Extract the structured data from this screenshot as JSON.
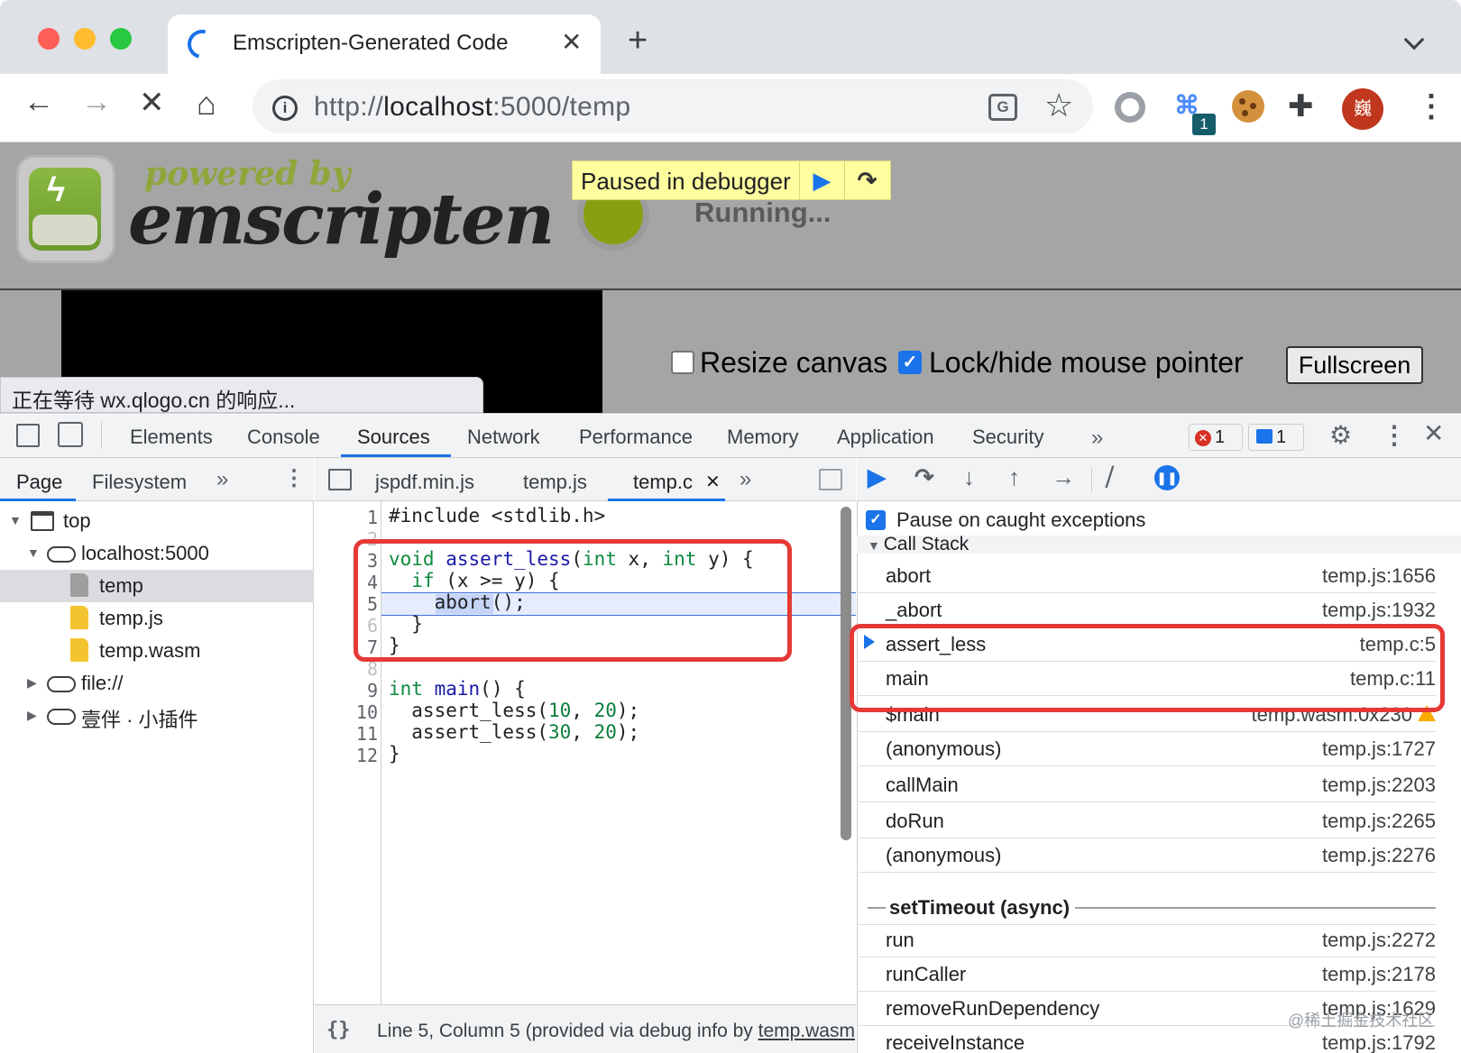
{
  "browser": {
    "tab_title": "Emscripten-Generated Code",
    "url_prefix": "http://",
    "url_host": "localhost",
    "url_rest": ":5000/temp",
    "extension_badge": "1",
    "avatar_text": "巍",
    "status_text": "正在等待 wx.qlogo.cn 的响应..."
  },
  "page": {
    "powered_by": "powered by",
    "brand": "emscripten",
    "running": "Running...",
    "paused_banner": "Paused in debugger",
    "resize_canvas_label": "Resize canvas",
    "resize_canvas_checked": false,
    "lock_pointer_label": "Lock/hide mouse pointer",
    "lock_pointer_checked": true,
    "fullscreen_label": "Fullscreen"
  },
  "devtools": {
    "tabs": [
      "Elements",
      "Console",
      "Sources",
      "Network",
      "Performance",
      "Memory",
      "Application",
      "Security"
    ],
    "active_tab": "Sources",
    "error_count": "1",
    "message_count": "1"
  },
  "navigator": {
    "tabs": [
      "Page",
      "Filesystem"
    ],
    "tree": [
      {
        "label": "top"
      },
      {
        "label": "localhost:5000"
      },
      {
        "label": "temp"
      },
      {
        "label": "temp.js"
      },
      {
        "label": "temp.wasm"
      },
      {
        "label": "file://"
      },
      {
        "label": "壹伴 · 小插件"
      }
    ]
  },
  "editor": {
    "tabs": [
      "jspdf.min.js",
      "temp.js",
      "temp.c"
    ],
    "active_tab": "temp.c",
    "line_numbers": [
      "1",
      "2",
      "3",
      "4",
      "5",
      "6",
      "7",
      "8",
      "9",
      "10",
      "11",
      "12"
    ],
    "status": "Line 5, Column 5  (provided via debug info by ",
    "status_link": "temp.wasm",
    "pretty_print": "{}"
  },
  "debugger": {
    "pause_on_caught_label": "Pause on caught exceptions",
    "pause_on_caught_checked": true,
    "call_stack_title": "Call Stack",
    "frames": [
      {
        "name": "abort",
        "loc": "temp.js:1656"
      },
      {
        "name": "_abort",
        "loc": "temp.js:1932"
      },
      {
        "name": "assert_less",
        "loc": "temp.c:5",
        "current": true
      },
      {
        "name": "main",
        "loc": "temp.c:11"
      },
      {
        "name": "$main",
        "loc": "temp.wasm:0x230",
        "warning": true
      },
      {
        "name": "(anonymous)",
        "loc": "temp.js:1727"
      },
      {
        "name": "callMain",
        "loc": "temp.js:2203"
      },
      {
        "name": "doRun",
        "loc": "temp.js:2265"
      },
      {
        "name": "(anonymous)",
        "loc": "temp.js:2276"
      }
    ],
    "async_label": "setTimeout (async)",
    "frames_after": [
      {
        "name": "run",
        "loc": "temp.js:2272"
      },
      {
        "name": "runCaller",
        "loc": "temp.js:2178"
      },
      {
        "name": "removeRunDependency",
        "loc": "temp.js:1629"
      },
      {
        "name": "receiveInstance",
        "loc": "temp.js:1792"
      }
    ]
  },
  "watermark": "@稀土掘金技术社区",
  "colors": {
    "accent": "#1a73e8",
    "highlight_box": "#e53935",
    "paused_banner": "#fefe9f"
  }
}
